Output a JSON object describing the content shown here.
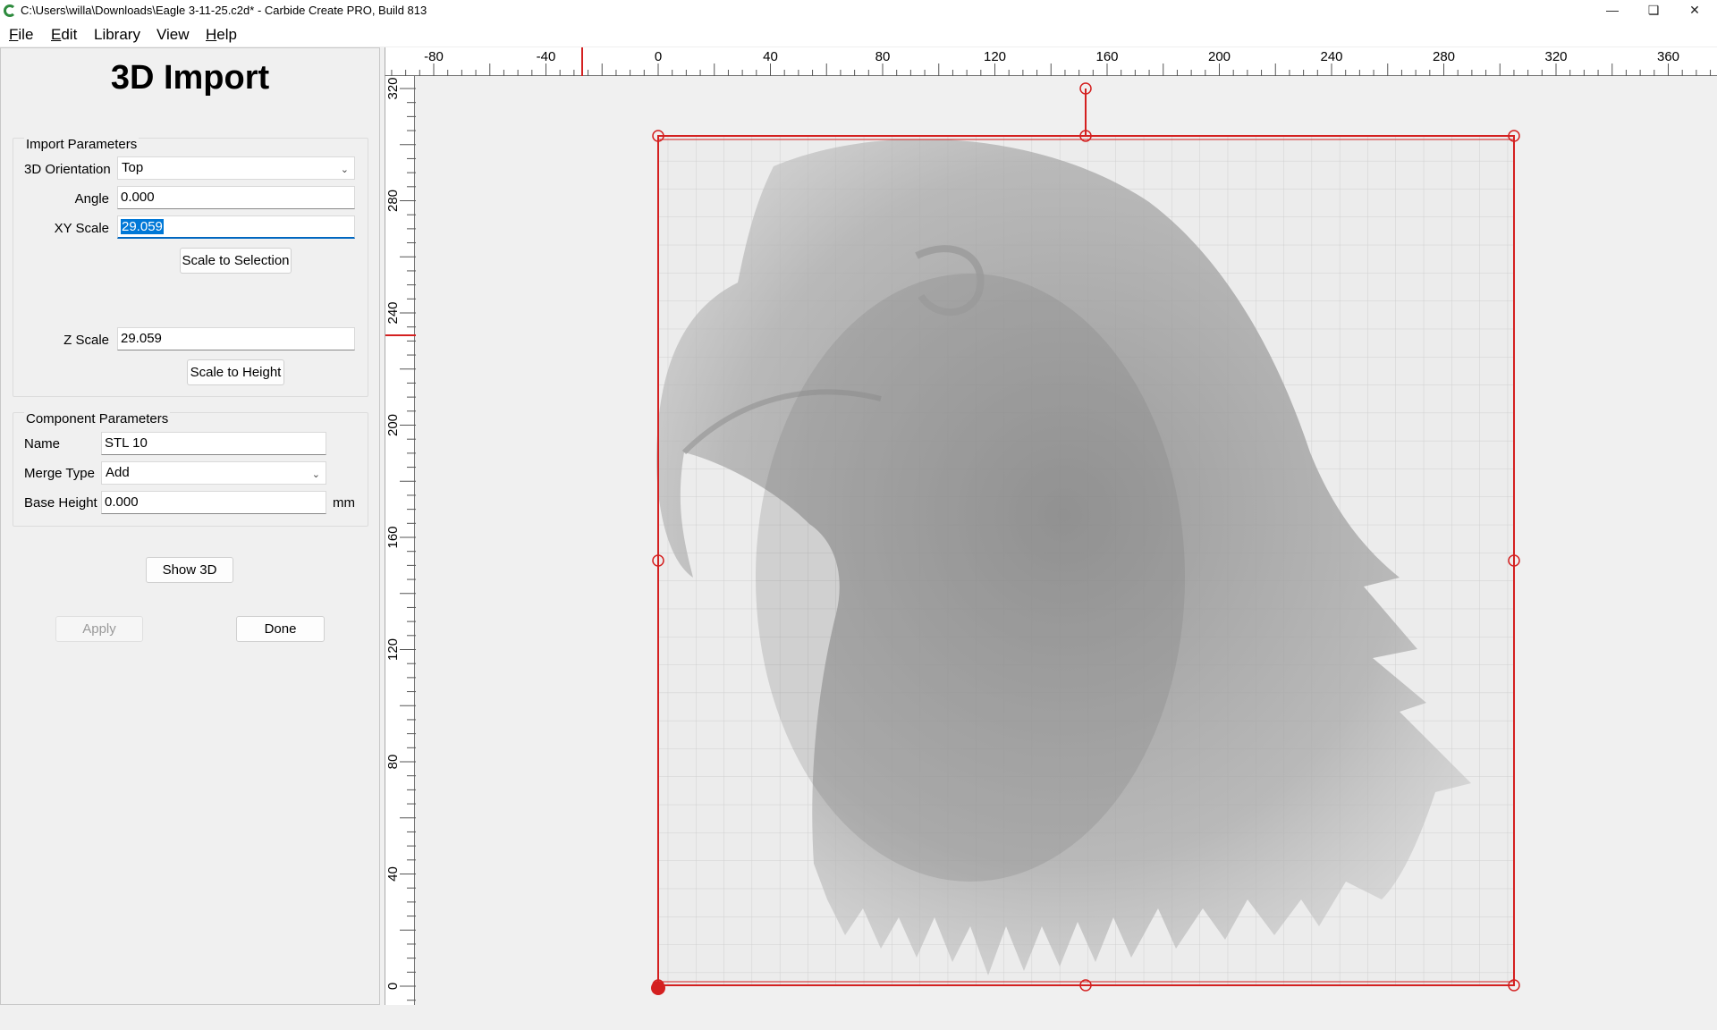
{
  "window": {
    "title": "C:\\Users\\willa\\Downloads\\Eagle 3-11-25.c2d* - Carbide Create PRO, Build 813",
    "minimize_icon": "minimize-icon",
    "restore_icon": "restore-icon",
    "close_icon": "close-icon"
  },
  "menu": [
    "File",
    "Edit",
    "Library",
    "View",
    "Help"
  ],
  "panel": {
    "title": "3D Import",
    "import_params": {
      "group_title": "Import Parameters",
      "orientation_label": "3D Orientation",
      "orientation_value": "Top",
      "angle_label": "Angle",
      "angle_value": "0.000",
      "xy_scale_label": "XY Scale",
      "xy_scale_value": "29.059",
      "scale_to_selection": "Scale to Selection",
      "z_scale_label": "Z Scale",
      "z_scale_value": "29.059",
      "scale_to_height": "Scale to Height"
    },
    "component_params": {
      "group_title": "Component Parameters",
      "name_label": "Name",
      "name_value": "STL 10",
      "merge_type_label": "Merge Type",
      "merge_type_value": "Add",
      "base_height_label": "Base Height",
      "base_height_value": "0.000",
      "unit": "mm"
    },
    "show_3d": "Show 3D",
    "apply": "Apply",
    "done": "Done"
  },
  "rulers": {
    "horizontal_labels": [
      "-80",
      "-40",
      "0",
      "40",
      "80",
      "120",
      "160",
      "200",
      "240",
      "280",
      "320",
      "360"
    ],
    "vertical_labels": [
      "320",
      "280",
      "240",
      "200",
      "160",
      "120",
      "80",
      "40",
      "0"
    ]
  },
  "colors": {
    "accent": "#0078d7",
    "selection_red": "#d42020"
  }
}
